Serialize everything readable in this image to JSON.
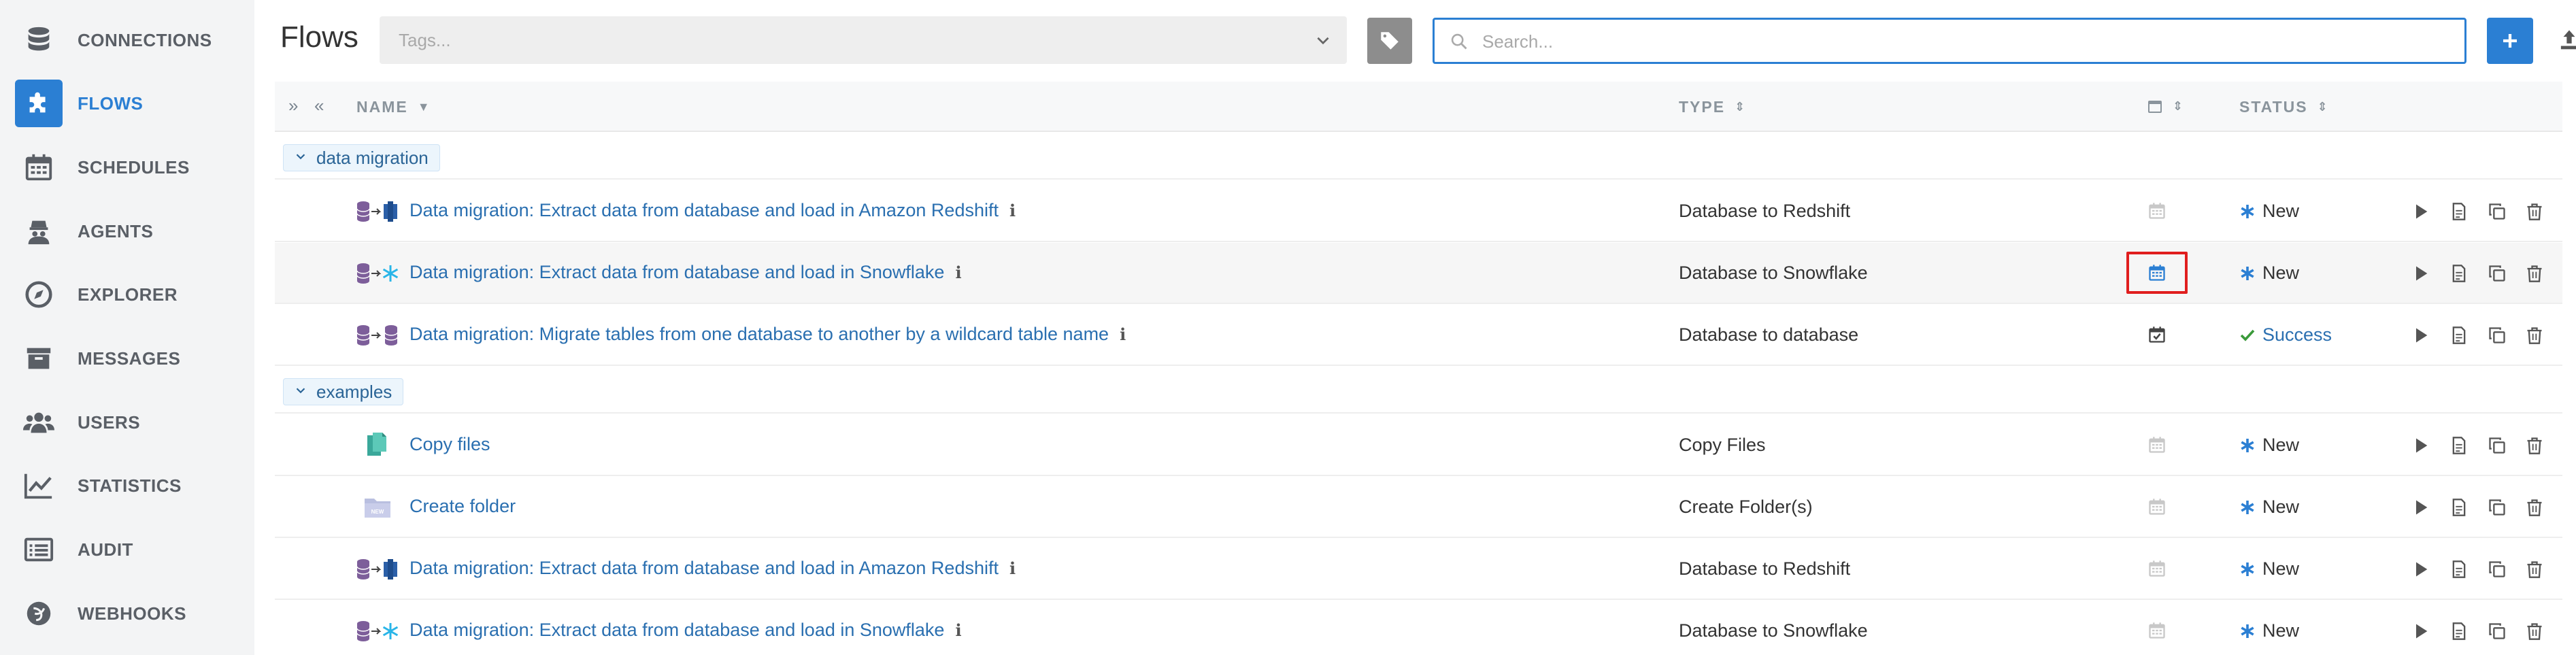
{
  "sidebar": {
    "items": [
      {
        "label": "CONNECTIONS",
        "icon": "database-icon",
        "active": false
      },
      {
        "label": "FLOWS",
        "icon": "puzzle-icon",
        "active": true
      },
      {
        "label": "SCHEDULES",
        "icon": "calendar-icon",
        "active": false
      },
      {
        "label": "AGENTS",
        "icon": "agent-icon",
        "active": false
      },
      {
        "label": "EXPLORER",
        "icon": "compass-icon",
        "active": false
      },
      {
        "label": "MESSAGES",
        "icon": "archive-icon",
        "active": false
      },
      {
        "label": "USERS",
        "icon": "users-icon",
        "active": false
      },
      {
        "label": "STATISTICS",
        "icon": "line-chart-icon",
        "active": false
      },
      {
        "label": "AUDIT",
        "icon": "list-icon",
        "active": false
      },
      {
        "label": "WEBHOOKS",
        "icon": "webhook-icon",
        "active": false
      }
    ]
  },
  "header": {
    "title": "Flows",
    "tags_placeholder": "Tags...",
    "search_placeholder": "Search...",
    "search_value": ""
  },
  "table": {
    "columns": {
      "name": "NAME",
      "type": "TYPE",
      "status": "STATUS"
    },
    "groups": [
      {
        "name": "data migration",
        "rows": [
          {
            "name": "Data migration: Extract data from database and load in Amazon Redshift",
            "type": "Database to Redshift",
            "status": "New",
            "icon": "db-to-redshift-icon",
            "info": true,
            "schedule": "none"
          },
          {
            "name": "Data migration: Extract data from database and load in Snowflake",
            "type": "Database to Snowflake",
            "status": "New",
            "icon": "db-to-snowflake-icon",
            "info": true,
            "schedule": "highlighted"
          },
          {
            "name": "Data migration: Migrate tables from one database to another by a wildcard table name",
            "type": "Database to database",
            "status": "Success",
            "icon": "db-to-db-icon",
            "info": true,
            "schedule": "scheduled"
          }
        ]
      },
      {
        "name": "examples",
        "rows": [
          {
            "name": "Copy files",
            "type": "Copy Files",
            "status": "New",
            "icon": "copy-files-icon",
            "info": false,
            "schedule": "none"
          },
          {
            "name": "Create folder",
            "type": "Create Folder(s)",
            "status": "New",
            "icon": "new-folder-icon",
            "info": false,
            "schedule": "none"
          },
          {
            "name": "Data migration: Extract data from database and load in Amazon Redshift",
            "type": "Database to Redshift",
            "status": "New",
            "icon": "db-to-redshift-icon",
            "info": true,
            "schedule": "none"
          },
          {
            "name": "Data migration: Extract data from database and load in Snowflake",
            "type": "Database to Snowflake",
            "status": "New",
            "icon": "db-to-snowflake-icon",
            "info": true,
            "schedule": "none"
          }
        ]
      }
    ]
  },
  "colors": {
    "accent": "#2b7fd3",
    "link": "#2a6fb0",
    "success": "#3a9a3a",
    "highlight": "#e01e1e"
  }
}
